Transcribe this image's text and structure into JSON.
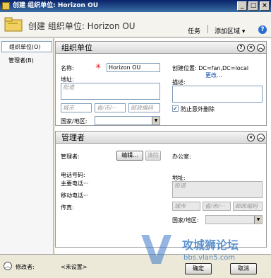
{
  "window": {
    "title": "创建 组织单位: Horizon OU",
    "minimize": "_",
    "maximize": "□",
    "close": "×"
  },
  "header": {
    "title": "创建 组织单位: Horizon OU",
    "tasks": "任务",
    "add_zone": "添加区域 ▾",
    "help": "?"
  },
  "sidebar": {
    "items": [
      {
        "label": "组织单位(O)",
        "active": true
      },
      {
        "label": "管理者(B)",
        "active": false
      }
    ]
  },
  "ou_section": {
    "title": "组织单位",
    "name_label": "名称:",
    "name_value": "Horizon OU",
    "required_mark": "✳",
    "address_label": "地址:",
    "street_placeholder": "街道",
    "city_placeholder": "城市",
    "state_placeholder": "省/市/···",
    "zip_placeholder": "邮政编码",
    "country_label": "国家/地区:",
    "country_value": "",
    "location_label": "创建位置: DC=fan,DC=local",
    "change_link": "更改...",
    "description_label": "描述:",
    "description_value": "",
    "protect_label": "防止意外删除",
    "protect_checked": true
  },
  "manager_section": {
    "title": "管理者",
    "manager_label": "管理者:",
    "edit_button": "编辑...",
    "clear_button": "清除",
    "office_label": "办公室:",
    "phone_label": "电话号码:",
    "main_phone_label": "主要电话···",
    "mobile_label": "移动电话···",
    "fax_label": "传真:",
    "address_label": "地址:",
    "street_placeholder": "街道",
    "city_placeholder": "城市",
    "state_placeholder": "省/市/···",
    "zip_placeholder": "邮政编码",
    "country_label": "国家/地区:",
    "country_value": ""
  },
  "footer": {
    "modified_label": "修改者:",
    "modified_value": "<未设置>",
    "ok_button": "确定",
    "cancel_button": "取消"
  },
  "watermark": {
    "logo": "V",
    "text": "攻城狮论坛",
    "url": "bbs.vlan5.com"
  }
}
